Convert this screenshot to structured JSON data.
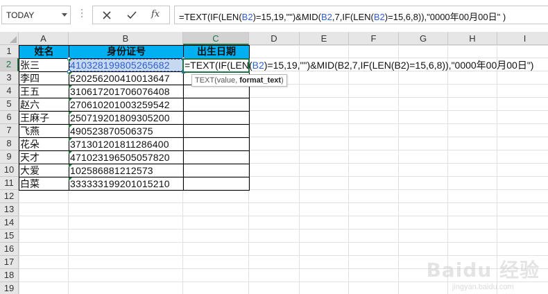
{
  "name_box": {
    "value": "TODAY"
  },
  "formula_bar": {
    "segments": [
      {
        "text": "=TEXT(IF(LEN(",
        "color": "#111111"
      },
      {
        "text": "B2",
        "color": "#2e5fd1"
      },
      {
        "text": ")=15,19,\"\")&MID(",
        "color": "#111111"
      },
      {
        "text": "B2",
        "color": "#2e5fd1"
      },
      {
        "text": ",7,IF(LEN(",
        "color": "#111111"
      },
      {
        "text": "B2",
        "color": "#2e5fd1"
      },
      {
        "text": ")=15,6,8)),\"0000年00月00日\" )",
        "color": "#111111"
      }
    ]
  },
  "columns": [
    "A",
    "B",
    "C",
    "D",
    "E",
    "F",
    "G",
    "H",
    "I"
  ],
  "rows": [
    "1",
    "2",
    "3",
    "4",
    "5",
    "6",
    "7",
    "8",
    "9",
    "10",
    "11",
    "12",
    "13",
    "14",
    "15",
    "16",
    "17",
    "18",
    "19"
  ],
  "header_row": {
    "name": "姓名",
    "id": "身份证号",
    "birth": "出生日期"
  },
  "records": [
    {
      "name": "张三",
      "id": "410328199805265682"
    },
    {
      "name": "李四",
      "id": "520256200410013647"
    },
    {
      "name": "王五",
      "id": "310617201706076408"
    },
    {
      "name": "赵六",
      "id": "270610201003259542"
    },
    {
      "name": "王麻子",
      "id": "250719201809305200"
    },
    {
      "name": "飞燕",
      "id": "490523870506375"
    },
    {
      "name": "花朵",
      "id": "371301201811286400"
    },
    {
      "name": "天才",
      "id": "471023196505057820"
    },
    {
      "name": "大爱",
      "id": "102586881212573"
    },
    {
      "name": "白菜",
      "id": "333333199201015210"
    }
  ],
  "editing_cell": {
    "segments": [
      {
        "text": "=TEXT(IF(LEN(",
        "color": "#111111"
      },
      {
        "text": "B2",
        "color": "#2e5fd1"
      },
      {
        "text": ")=15,19,\"\")&MID(B2,7,IF(LEN(B2)=15,6,8)),\"0000年00月00日\")",
        "color": "#111111"
      }
    ]
  },
  "tooltip": {
    "fn": "TEXT(value, ",
    "bold": "format_text",
    "close": ")"
  },
  "watermark": {
    "logo": "Baidu 经验",
    "url": "jingyan.baidu.com"
  },
  "colors": {
    "header_fill": "#00b0f0",
    "excel_green": "#217346",
    "ref_blue": "#2e5fd1"
  }
}
